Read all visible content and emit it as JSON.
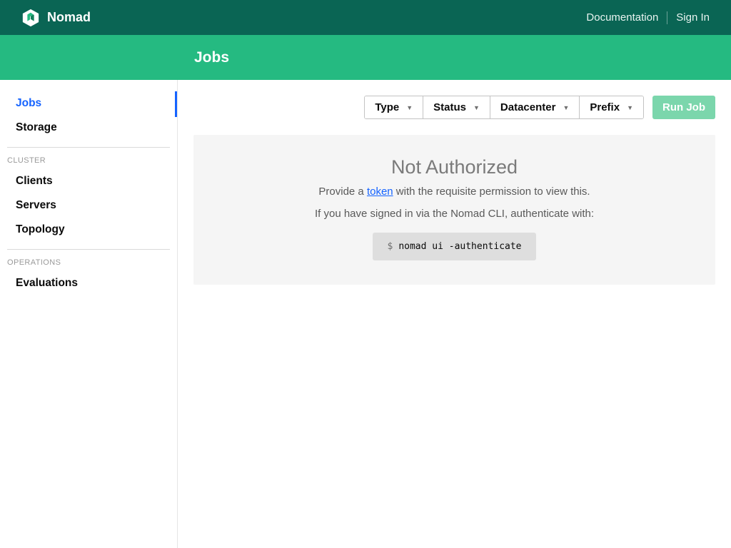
{
  "header": {
    "brand": "Nomad",
    "links": {
      "documentation": "Documentation",
      "sign_in": "Sign In"
    }
  },
  "subheader": {
    "title": "Jobs"
  },
  "sidebar": {
    "top": [
      {
        "label": "Jobs",
        "active": true
      },
      {
        "label": "Storage",
        "active": false
      }
    ],
    "sections": [
      {
        "heading": "CLUSTER",
        "items": [
          "Clients",
          "Servers",
          "Topology"
        ]
      },
      {
        "heading": "OPERATIONS",
        "items": [
          "Evaluations"
        ]
      }
    ]
  },
  "toolbar": {
    "filters": [
      "Type",
      "Status",
      "Datacenter",
      "Prefix"
    ],
    "run_job": "Run Job"
  },
  "empty_state": {
    "title": "Not Authorized",
    "line1_pre": "Provide a ",
    "line1_link": "token",
    "line1_post": " with the requisite permission to view this.",
    "line2": "If you have signed in via the Nomad CLI, authenticate with:",
    "cli_prompt": "$",
    "cli_command": "nomad ui -authenticate"
  }
}
